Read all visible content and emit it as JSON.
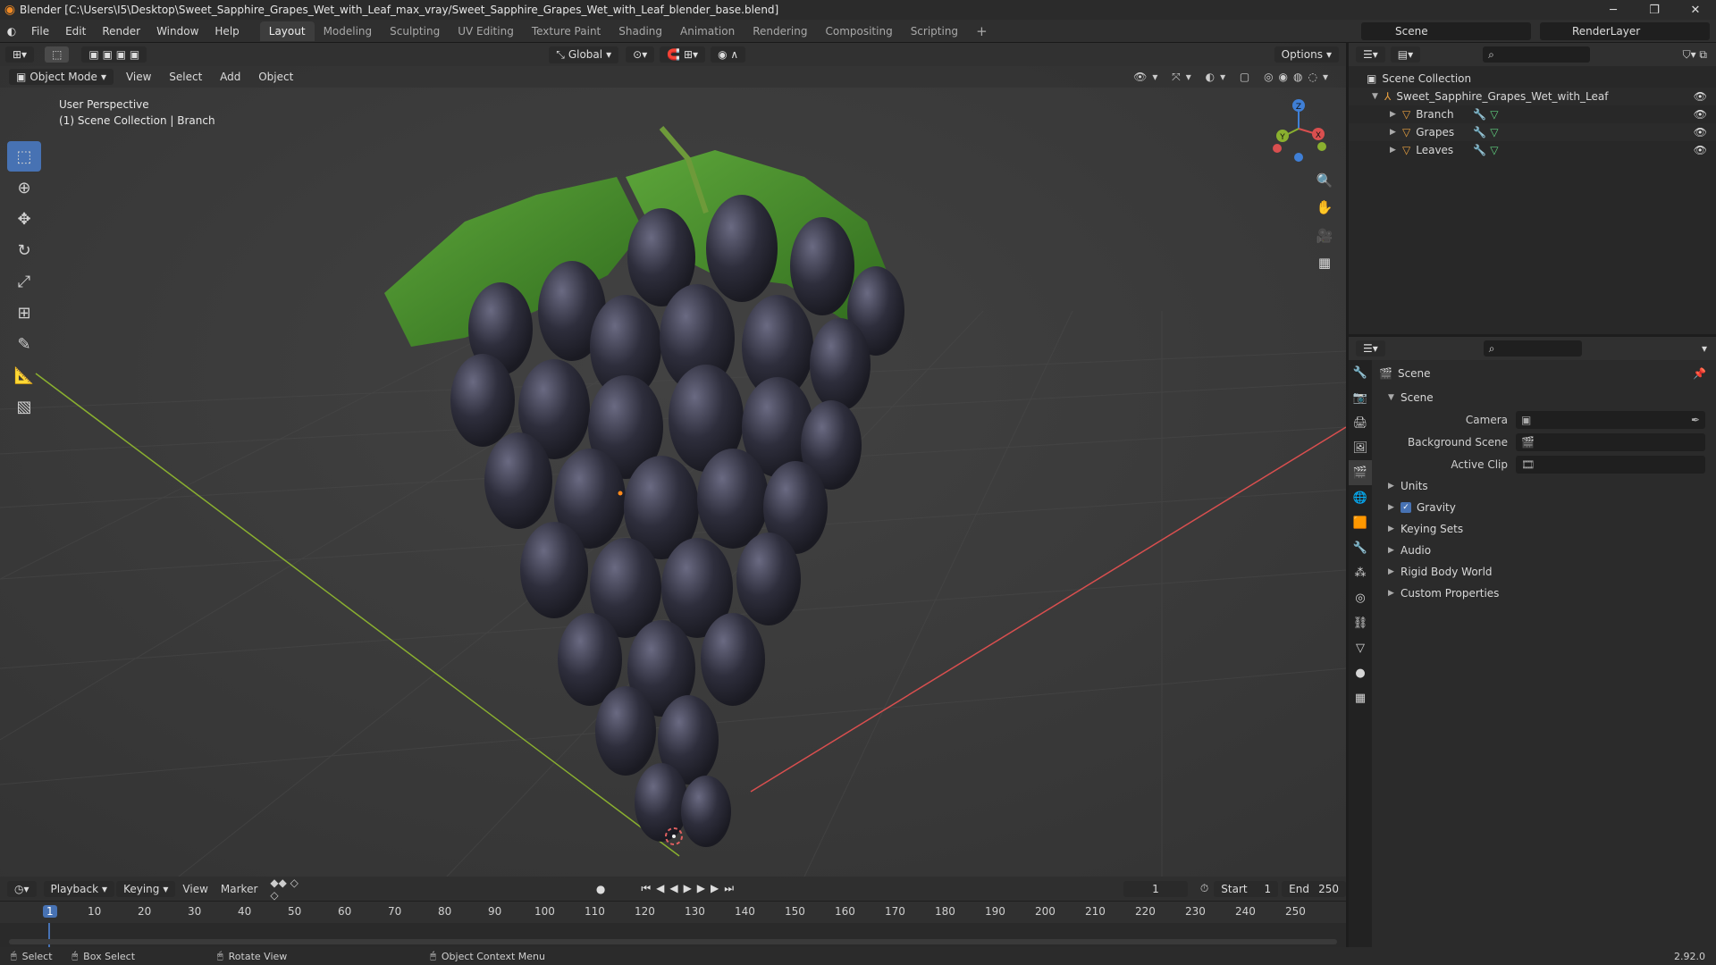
{
  "window": {
    "title": "Blender [C:\\Users\\I5\\Desktop\\Sweet_Sapphire_Grapes_Wet_with_Leaf_max_vray/Sweet_Sapphire_Grapes_Wet_with_Leaf_blender_base.blend]",
    "controls": [
      "─",
      "❐",
      "✕"
    ]
  },
  "menu": [
    "File",
    "Edit",
    "Render",
    "Window",
    "Help"
  ],
  "workspaces": [
    "Layout",
    "Modeling",
    "Sculpting",
    "UV Editing",
    "Texture Paint",
    "Shading",
    "Animation",
    "Rendering",
    "Compositing",
    "Scripting"
  ],
  "active_workspace": "Layout",
  "scene_selector": "Scene",
  "render_layer": "RenderLayer",
  "viewport": {
    "transform_orientation": "Global",
    "options_label": "Options",
    "mode": "Object Mode",
    "header_menu": [
      "View",
      "Select",
      "Add",
      "Object"
    ],
    "overlay_line1": "User Perspective",
    "overlay_line2": "(1) Scene Collection | Branch",
    "gizmo": {
      "x": "X",
      "y": "Y",
      "z": "Z"
    }
  },
  "tools": [
    "select-box",
    "cursor",
    "move",
    "rotate",
    "scale",
    "transform",
    "annotate",
    "measure",
    "add-cube"
  ],
  "timeline": {
    "menus": [
      "Playback",
      "Keying",
      "View",
      "Marker"
    ],
    "current_frame": "1",
    "start_label": "Start",
    "start_value": "1",
    "end_label": "End",
    "end_value": "250",
    "ruler": [
      "1",
      "10",
      "20",
      "30",
      "40",
      "50",
      "60",
      "70",
      "80",
      "90",
      "100",
      "110",
      "120",
      "130",
      "140",
      "150",
      "160",
      "170",
      "180",
      "190",
      "200",
      "210",
      "220",
      "230",
      "240",
      "250"
    ]
  },
  "status": {
    "select": "Select",
    "box_select": "Box Select",
    "rotate_view": "Rotate View",
    "context_menu": "Object Context Menu",
    "version": "2.92.0"
  },
  "outliner": {
    "root": "Scene Collection",
    "collection": "Sweet_Sapphire_Grapes_Wet_with_Leaf",
    "objects": [
      "Branch",
      "Grapes",
      "Leaves"
    ]
  },
  "properties": {
    "context": "Scene",
    "panel_title": "Scene",
    "fields": [
      {
        "label": "Camera",
        "value": ""
      },
      {
        "label": "Background Scene",
        "value": ""
      },
      {
        "label": "Active Clip",
        "value": ""
      }
    ],
    "sections": [
      "Units",
      "Gravity",
      "Keying Sets",
      "Audio",
      "Rigid Body World",
      "Custom Properties"
    ],
    "gravity_checked": true
  },
  "colors": {
    "accent": "#4772b3",
    "x_axis": "#d94f4f",
    "y_axis": "#8ab02f",
    "z_axis": "#3f7fd6",
    "grape": "#3a3a4a",
    "leaf": "#4a8a2a"
  }
}
